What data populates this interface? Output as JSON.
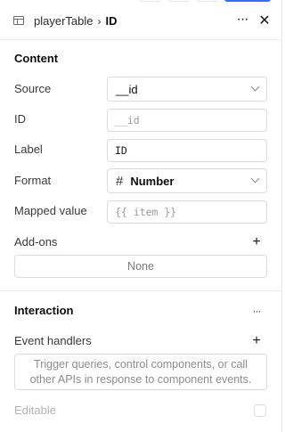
{
  "header": {
    "parent": "playerTable",
    "separator": "›",
    "current": "ID",
    "more_glyph": "···",
    "close_glyph": "✕"
  },
  "content": {
    "title": "Content",
    "source": {
      "label": "Source",
      "value": "__id"
    },
    "id": {
      "label": "ID",
      "placeholder": "__id"
    },
    "label": {
      "label": "Label",
      "value": "ID"
    },
    "format": {
      "label": "Format",
      "icon": "#",
      "value": "Number"
    },
    "mapped": {
      "label": "Mapped value",
      "placeholder": "{{ item }}"
    },
    "addons": {
      "label": "Add-ons",
      "plus": "+",
      "empty": "None"
    }
  },
  "interaction": {
    "title": "Interaction",
    "more_glyph": "···",
    "event_handlers": {
      "label": "Event handlers",
      "plus": "+",
      "empty": "Trigger queries, control components, or call other APIs in response to component events."
    },
    "editable": {
      "label": "Editable",
      "checked": false
    }
  },
  "colors": {
    "accent": "#3170f9",
    "border": "#dcdcdc",
    "muted_text": "#b3b3b3"
  }
}
